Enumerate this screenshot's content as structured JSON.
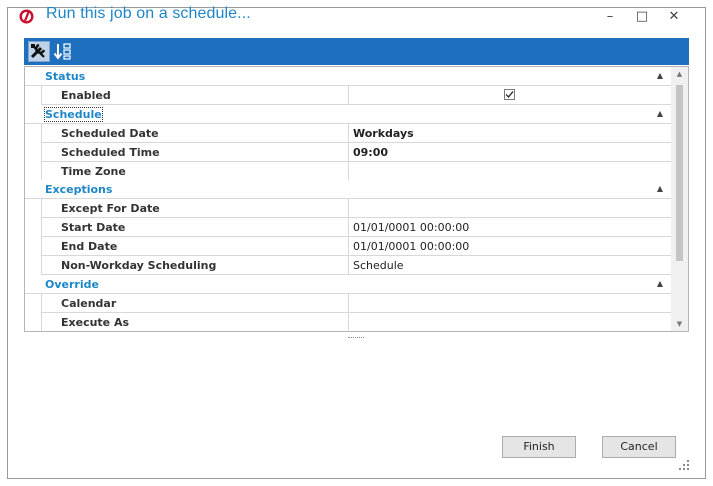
{
  "window": {
    "title": "Run this job on a schedule...",
    "controls": {
      "minimize": "–",
      "maximize": "□",
      "close": "✕"
    }
  },
  "toolbar": {
    "buttons": [
      {
        "icon": "tools-icon",
        "active": true
      },
      {
        "icon": "sort-alphabetical-icon",
        "active": false
      }
    ]
  },
  "grid": {
    "categories": {
      "status": {
        "label": "Status"
      },
      "schedule": {
        "label": "Schedule"
      },
      "exceptions": {
        "label": "Exceptions"
      },
      "override": {
        "label": "Override"
      }
    },
    "rows": {
      "enabled": {
        "label": "Enabled",
        "checked": true
      },
      "scheduled_date": {
        "label": "Scheduled Date",
        "value": "Workdays"
      },
      "scheduled_time": {
        "label": "Scheduled Time",
        "value": "09:00"
      },
      "time_zone": {
        "label": "Time Zone",
        "value": ""
      },
      "except_for_date": {
        "label": "Except For Date",
        "value": ""
      },
      "start_date": {
        "label": "Start Date",
        "value": "01/01/0001 00:00:00"
      },
      "end_date": {
        "label": "End Date",
        "value": "01/01/0001 00:00:00"
      },
      "non_workday": {
        "label": "Non-Workday Scheduling",
        "value": "Schedule"
      },
      "calendar": {
        "label": "Calendar",
        "value": ""
      },
      "execute_as": {
        "label": "Execute As",
        "value": ""
      }
    },
    "collapse_glyph": "▲"
  },
  "footer": {
    "finish_label": "Finish",
    "cancel_label": "Cancel"
  },
  "colors": {
    "accent": "#1e70bf",
    "category_text": "#1d87c8",
    "title_text": "#1e86c8"
  }
}
